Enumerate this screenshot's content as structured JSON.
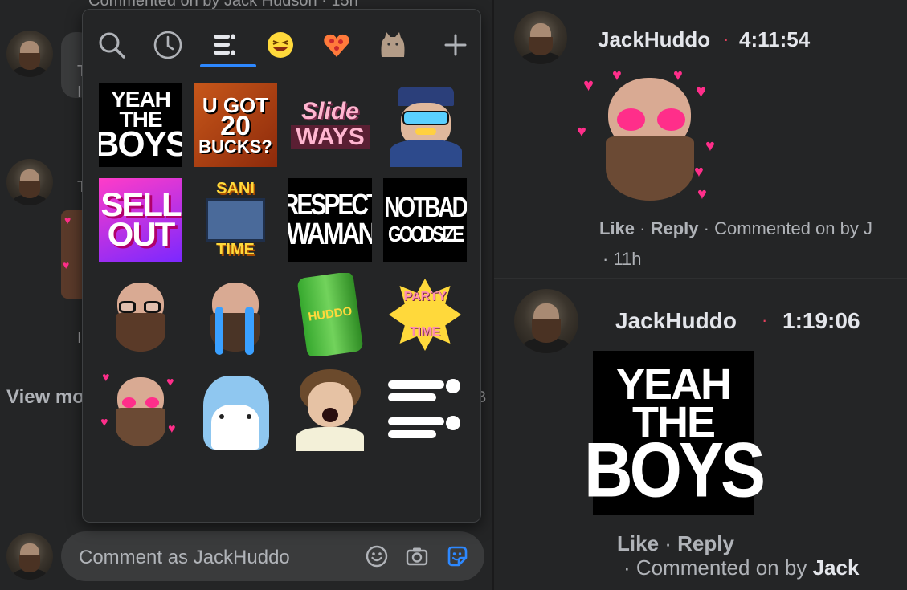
{
  "left": {
    "top_meta_text": "Commented on by Jack Hudson · 15h",
    "view_more_text": "View mo",
    "partial_letters": [
      "T",
      "I",
      "T",
      "I",
      "B"
    ]
  },
  "picker": {
    "tabs": [
      {
        "name": "search",
        "icon": "search-icon"
      },
      {
        "name": "recent",
        "icon": "clock-icon"
      },
      {
        "name": "pack-huddo",
        "icon": "sticker-pack-icon",
        "active": true
      },
      {
        "name": "pack-emoji",
        "icon": "laughing-face-icon"
      },
      {
        "name": "pack-heart",
        "icon": "heart-pizza-icon"
      },
      {
        "name": "pack-pusheen",
        "icon": "cat-icon"
      },
      {
        "name": "add",
        "icon": "plus-icon"
      }
    ],
    "stickers": {
      "yeah": [
        "YEAH",
        "THE",
        "BOYS"
      ],
      "ugot": [
        "U GOT",
        "20",
        "BUCKS?"
      ],
      "slide": [
        "Slide",
        "WAYS"
      ],
      "sellout": [
        "SELL",
        "OUT"
      ],
      "sani": [
        "SANI",
        "TIME"
      ],
      "respect": [
        "RESPECT",
        "WAMAN"
      ],
      "notbad": [
        "NOTBAD",
        "GOODSIZE"
      ],
      "huddo_can": "HUDDO",
      "party": [
        "PARTY",
        "TIME"
      ]
    }
  },
  "composer": {
    "placeholder": "Comment as JackHuddo"
  },
  "comments": [
    {
      "author": "JackHuddo",
      "timestamp": "4:11:54",
      "like": "Like",
      "reply": "Reply",
      "meta_line1": "· Commented on by J",
      "meta_line2": "· 11h"
    },
    {
      "author": "JackHuddo",
      "timestamp": "1:19:06",
      "sticker_text": [
        "YEAH",
        "THE",
        "BOYS"
      ],
      "like": "Like",
      "reply": "Reply",
      "meta_prefix": "· Commented on by ",
      "meta_name": "Jack"
    }
  ],
  "colors": {
    "background": "#242526",
    "accent": "#2d88ff",
    "dot": "#e4415d",
    "muted_text": "#b0b3b8"
  }
}
